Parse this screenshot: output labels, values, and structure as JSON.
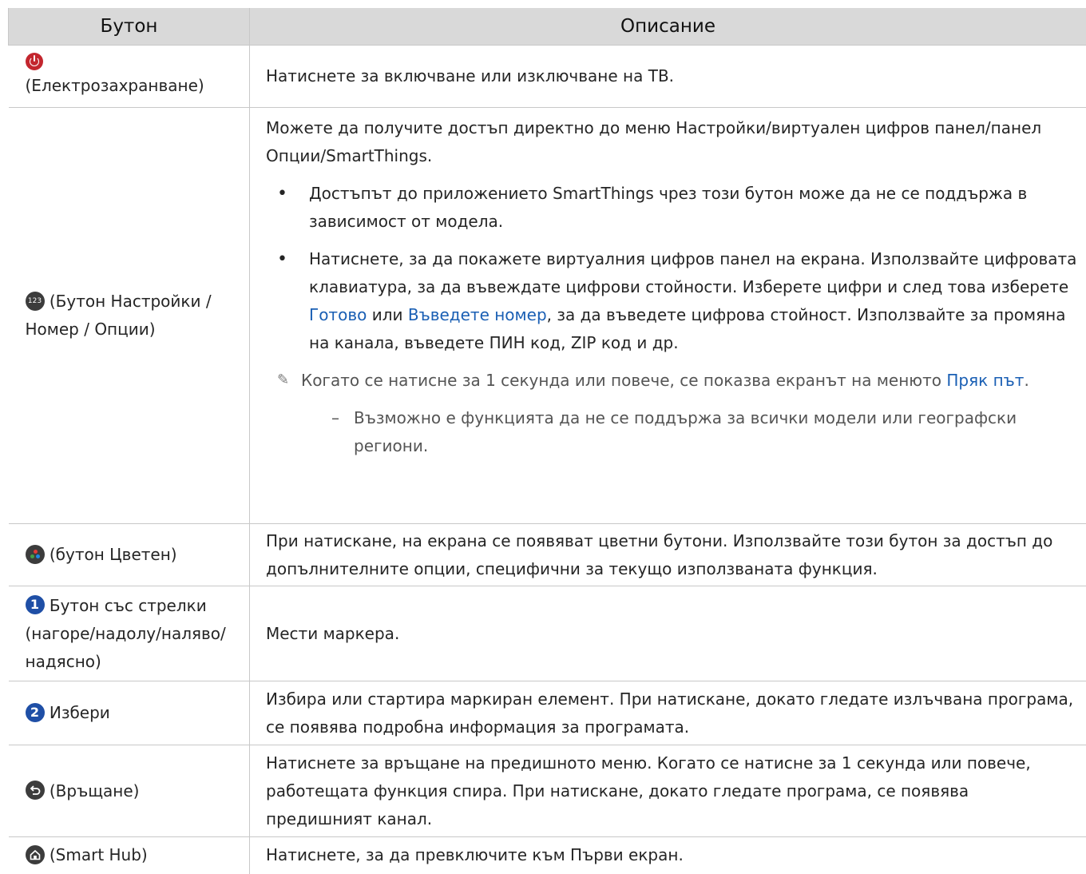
{
  "header": {
    "col_button": "Бутон",
    "col_description": "Описание"
  },
  "rows": [
    {
      "button": "(Електрозахранване)",
      "description": "Натиснете за включване или изключване на ТВ."
    },
    {
      "button": "(Бутон Настройки / Номер / Опции)",
      "intro": "Можете да получите достъп директно до меню Настройки/виртуален цифров панел/панел Опции/SmartThings.",
      "bullet1": "Достъпът до приложението SmartThings чрез този бутон може да не се поддържа в зависимост от модела.",
      "bullet2_a": "Натиснете, за да покажете виртуалния цифров панел на екрана. Използвайте цифровата клавиатура, за да въвеждате цифрови стойности. Изберете цифри и след това изберете ",
      "bullet2_link1": "Готово",
      "bullet2_b": " или ",
      "bullet2_link2": "Въведете номер",
      "bullet2_c": ", за да въведете цифрова стойност. Използвайте за промяна на канала, въведете ПИН код, ZIP код и др.",
      "note_a": "Когато се натисне за 1 секунда или повече, се показва екранът на менюто ",
      "note_link": "Пряк път",
      "note_b": ".",
      "subnote_dash": "–",
      "subnote": "Възможно е функцията да не се поддържа за всички модели или географски региони.",
      "icon_text": "123"
    },
    {
      "button": "(бутон Цветен)",
      "description": "При натискане, на екрана се появяват цветни бутони. Използвайте този бутон за достъп до допълнителните опции, специфични за текущо използваната функция."
    },
    {
      "badge": "1",
      "button": "Бутон със стрелки (нагоре/надолу/наляво/надясно)",
      "description": "Мести маркера."
    },
    {
      "badge": "2",
      "button": "Избери",
      "description": "Избира или стартира маркиран елемент. При натискане, докато гледате излъчвана програма, се появява подробна информация за програмата."
    },
    {
      "button": "(Връщане)",
      "description": "Натиснете за връщане на предишното меню. Когато се натисне за 1 секунда или повече, работещата функция спира. При натискане, докато гледате програма, се появява предишният канал."
    },
    {
      "button": "(Smart Hub)",
      "description": "Натиснете, за да превключите към Първи екран."
    }
  ],
  "colors": {
    "header_bg": "#d9d9d9",
    "link": "#1a5fb4",
    "power": "#c3262e",
    "badge": "#1f4fa6",
    "icon_dark": "#3c3c3c"
  },
  "icons": [
    "power-icon",
    "settings-number-icon",
    "color-button-icon",
    "number-1-badge",
    "number-2-badge",
    "return-icon",
    "home-icon",
    "pencil-note-icon"
  ]
}
